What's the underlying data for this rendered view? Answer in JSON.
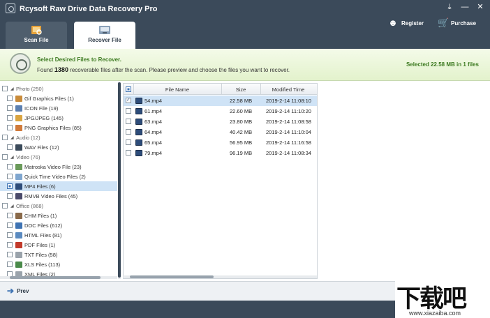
{
  "window": {
    "title": "Rcysoft Raw Drive Data Recovery Pro",
    "controls": [
      "⤓",
      "—",
      "✕"
    ]
  },
  "header": {
    "register_label": "Register",
    "purchase_label": "Purchase",
    "tabs": [
      {
        "label": "Scan File",
        "active": false
      },
      {
        "label": "Recover File",
        "active": true
      }
    ]
  },
  "infobar": {
    "heading": "Select Desired Files to Recover.",
    "found_prefix": "Found",
    "found_count": "1380",
    "found_suffix": "recoverable files after the scan. Please preview and choose the files you want to recover.",
    "selected_summary": "Selected 22.58 MB in 1 files"
  },
  "tree": [
    {
      "label": "Photo (250)",
      "category": true
    },
    {
      "label": "Gif Graphics Files (1)",
      "icon_color": "#c98b3a"
    },
    {
      "label": "ICON File (19)",
      "icon_color": "#5b7fb0"
    },
    {
      "label": "JPG/JPEG (145)",
      "icon_color": "#d9a441"
    },
    {
      "label": "PNG Graphics Files (85)",
      "icon_color": "#d07a3a"
    },
    {
      "label": "Audio (12)",
      "category": true
    },
    {
      "label": "WAV Files (12)",
      "icon_color": "#3b4a5a"
    },
    {
      "label": "Video (76)",
      "category": true
    },
    {
      "label": "Matroska Video File (23)",
      "icon_color": "#6a9a5a"
    },
    {
      "label": "Quick Time Video Files (2)",
      "icon_color": "#7fa6cf"
    },
    {
      "label": "MP4 Files (6)",
      "icon_color": "#2d4c7a",
      "selected": true,
      "partial": true
    },
    {
      "label": "RMVB Video Files (45)",
      "icon_color": "#4a4a6a"
    },
    {
      "label": "Office (868)",
      "category": true
    },
    {
      "label": "CHM Files (1)",
      "icon_color": "#8a6a4a"
    },
    {
      "label": "DOC Files (612)",
      "icon_color": "#3e73b3"
    },
    {
      "label": "HTML Files (81)",
      "icon_color": "#5a8ac0"
    },
    {
      "label": "PDF Files (1)",
      "icon_color": "#c23a2a"
    },
    {
      "label": "TXT Files (58)",
      "icon_color": "#9aa3ab"
    },
    {
      "label": "XLS Files (113)",
      "icon_color": "#4a8a4a"
    },
    {
      "label": "XML Files (2)",
      "icon_color": "#9aa3ab"
    }
  ],
  "table": {
    "columns": [
      "File Name",
      "Size",
      "Modified Time"
    ],
    "rows": [
      {
        "name": "54.mp4",
        "size": "22.58 MB",
        "modified": "2019-2-14 11:08:10",
        "checked": true
      },
      {
        "name": "61.mp4",
        "size": "22.60 MB",
        "modified": "2019-2-14 11:10:20",
        "checked": false
      },
      {
        "name": "63.mp4",
        "size": "23.80 MB",
        "modified": "2019-2-14 11:08:58",
        "checked": false
      },
      {
        "name": "64.mp4",
        "size": "40.42 MB",
        "modified": "2019-2-14 11:10:04",
        "checked": false
      },
      {
        "name": "65.mp4",
        "size": "56.95 MB",
        "modified": "2019-2-14 11:16:58",
        "checked": false
      },
      {
        "name": "79.mp4",
        "size": "96.19 MB",
        "modified": "2019-2-14 11:08:34",
        "checked": false
      }
    ]
  },
  "bottom": {
    "prev_label": "Prev"
  },
  "watermark": {
    "brand": "下载吧",
    "url": "www.xiazaiba.com"
  }
}
